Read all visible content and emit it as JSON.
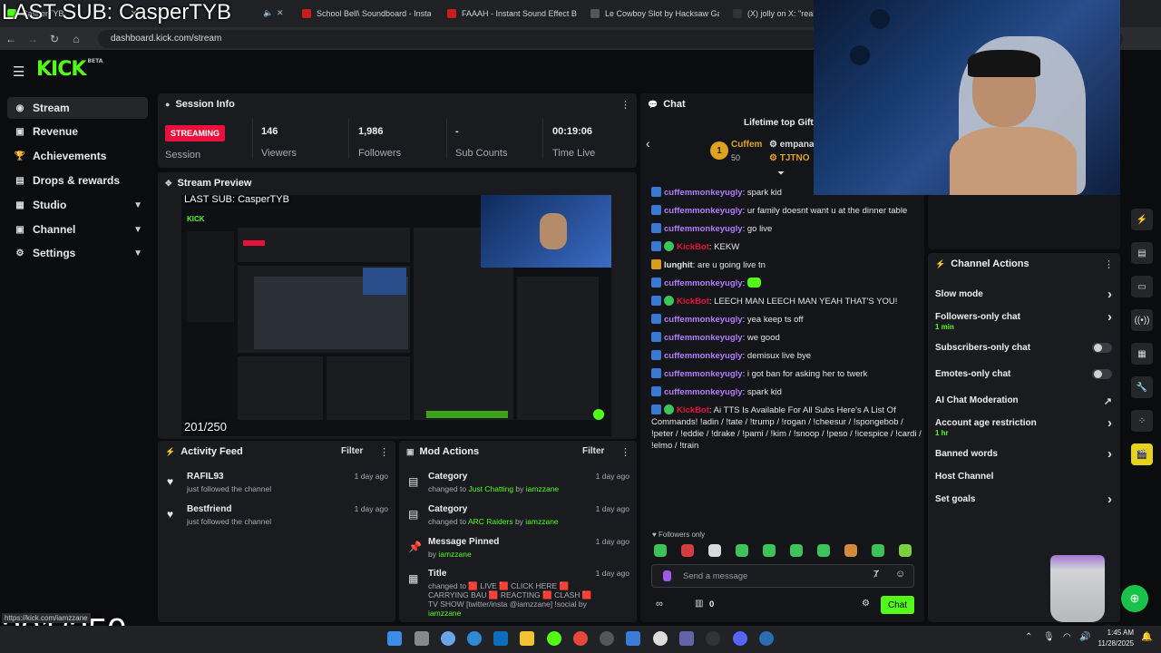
{
  "browser": {
    "tabs": [
      {
        "title": "CasperTYB",
        "color": "#53fc18"
      },
      {
        "title": "School Bell\\ Soundboard - Insta",
        "color": "#c91d1d"
      },
      {
        "title": "FAAAH - Instant Sound Effect B",
        "color": "#c91d1d"
      },
      {
        "title": "Le Cowboy Slot by Hacksaw Ga",
        "color": "#555"
      },
      {
        "title": "(X) jolly on X: \"really c",
        "color": "#333"
      }
    ],
    "url": "dashboard.kick.com/stream"
  },
  "overlay": {
    "top_title": "LAST SUB: CasperTYB",
    "counter": "201/250",
    "status_link": "https://kick.com/iamzzane"
  },
  "app": {
    "logo": "KICK",
    "logo_tag": "BETA"
  },
  "sidebar": {
    "items": [
      {
        "label": "Stream",
        "icon": "stream-icon"
      },
      {
        "label": "Revenue",
        "icon": "revenue-icon"
      },
      {
        "label": "Achievements",
        "icon": "trophy-icon"
      },
      {
        "label": "Drops & rewards",
        "icon": "gift-icon"
      },
      {
        "label": "Studio",
        "icon": "studio-icon"
      },
      {
        "label": "Channel",
        "icon": "channel-icon"
      },
      {
        "label": "Settings",
        "icon": "gear-icon"
      }
    ]
  },
  "session": {
    "title": "Session Info",
    "status": "STREAMING",
    "status_label": "Session",
    "viewers": "146",
    "viewers_label": "Viewers",
    "followers": "1,986",
    "followers_label": "Followers",
    "subs": "-",
    "subs_label": "Sub Counts",
    "time": "00:19:06",
    "time_label": "Time Live"
  },
  "preview": {
    "title": "Stream Preview",
    "overlay_title": "LAST SUB: CasperTYB",
    "counter": "201/250"
  },
  "activity": {
    "title": "Activity Feed",
    "filter": "Filter",
    "items": [
      {
        "name": "RAFIL93",
        "sub": "just followed the channel",
        "date": "1 day ago"
      },
      {
        "name": "Bestfriend",
        "sub": "just followed the channel",
        "date": "1 day ago"
      }
    ]
  },
  "mod": {
    "title": "Mod Actions",
    "filter": "Filter",
    "items": [
      {
        "title": "Category",
        "pre": "changed to ",
        "hl": "Just Chatting",
        "mid": " by ",
        "user": "iamzzane",
        "date": "1 day ago"
      },
      {
        "title": "Category",
        "pre": "changed to ",
        "hl": "ARC Raiders",
        "mid": " by ",
        "user": "iamzzane",
        "date": "1 day ago"
      },
      {
        "title": "Message Pinned",
        "pre": "by ",
        "hl": "",
        "mid": "",
        "user": "iamzzane",
        "date": "1 day ago"
      },
      {
        "title": "Title",
        "pre": "changed to 🟥 LIVE 🟥 CLICK HERE 🟥 CARRYING BAU 🟥 REACTING 🟥 CLASH 🟥 TV SHOW [twitter/insta @iamzzane] !social",
        "hl": "",
        "mid": " by ",
        "user": "iamzzane",
        "date": "1 day ago"
      }
    ]
  },
  "chat": {
    "title": "Chat",
    "gifters_title": "Lifetime top Gifte",
    "gifters": [
      {
        "name": "Cuffem",
        "count": "50",
        "rank": "1"
      },
      {
        "name": "empana",
        "count": ""
      },
      {
        "name": "TJTNO",
        "count": ""
      }
    ],
    "messages": [
      {
        "user": "cuffemmonkeyugly",
        "color": "#b67cff",
        "bot": false,
        "text": ": spark kid"
      },
      {
        "user": "cuffemmonkeyugly",
        "color": "#b67cff",
        "bot": false,
        "text": ": ur family doesnt want u at the dinner table"
      },
      {
        "user": "cuffemmonkeyugly",
        "color": "#b67cff",
        "bot": false,
        "text": ": go live"
      },
      {
        "user": "KickBot",
        "color": "#e9113c",
        "bot": true,
        "text": ": KEKW"
      },
      {
        "user": "lunghit",
        "color": "#e6e6e6",
        "bot": false,
        "text": ": are u going live tn"
      },
      {
        "user": "cuffemmonkeyugly",
        "color": "#b67cff",
        "bot": false,
        "text": ": ",
        "emote": true
      },
      {
        "user": "KickBot",
        "color": "#e9113c",
        "bot": true,
        "text": ": LEECH MAN LEECH MAN YEAH THAT'S YOU!"
      },
      {
        "user": "cuffemmonkeyugly",
        "color": "#b67cff",
        "bot": false,
        "text": ": yea keep ts off"
      },
      {
        "user": "cuffemmonkeyugly",
        "color": "#b67cff",
        "bot": false,
        "text": ": we good"
      },
      {
        "user": "cuffemmonkeyugly",
        "color": "#b67cff",
        "bot": false,
        "text": ": demisux live bye"
      },
      {
        "user": "cuffemmonkeyugly",
        "color": "#b67cff",
        "bot": false,
        "text": ": i got ban for asking her to twerk"
      },
      {
        "user": "cuffemmonkeyugly",
        "color": "#b67cff",
        "bot": false,
        "text": ": spark kid"
      },
      {
        "user": "KickBot",
        "color": "#e9113c",
        "bot": true,
        "text": ": Ai TTS Is Available For All Subs Here's A List Of Commands! !adin / !tate / !trump / !rogan / !cheesur / !spongebob / !peter / !eddie / !drake / !pami / !kim / !snoop / !peso / !icespice / !cardi / !elmo / !train"
      }
    ],
    "followers_only": "Followers only",
    "emote_count": 10,
    "placeholder": "Send a message",
    "points": "0",
    "send": "Chat"
  },
  "channel_actions": {
    "title": "Channel Actions",
    "items": [
      {
        "label": "Slow mode",
        "sub": "",
        "control": "chevron"
      },
      {
        "label": "Followers-only chat",
        "sub": "1 min",
        "control": "chevron"
      },
      {
        "label": "Subscribers-only chat",
        "sub": "",
        "control": "toggle"
      },
      {
        "label": "Emotes-only chat",
        "sub": "",
        "control": "toggle"
      },
      {
        "label": "AI Chat Moderation",
        "sub": "",
        "control": "external"
      },
      {
        "label": "Account age restriction",
        "sub": "1 hr",
        "control": "chevron"
      },
      {
        "label": "Banned words",
        "sub": "",
        "control": "chevron"
      },
      {
        "label": "Host Channel",
        "sub": "",
        "control": "none"
      },
      {
        "label": "Set goals",
        "sub": "",
        "control": "chevron"
      }
    ]
  },
  "taskbar": {
    "time": "1:45 AM",
    "date": "11/28/2025"
  }
}
